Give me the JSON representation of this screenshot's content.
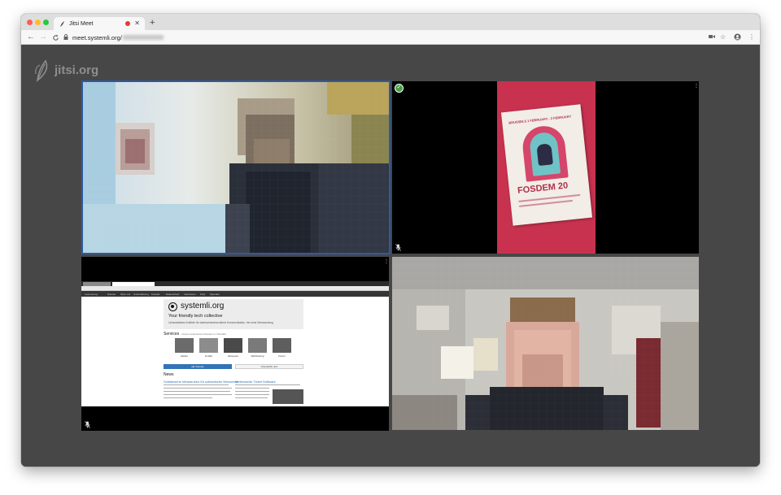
{
  "browser": {
    "tab_title": "Jitsi Meet",
    "tab_recording": true,
    "new_tab": "+",
    "url": "meet.systemli.org/",
    "nav": {
      "back": "←",
      "forward": "→",
      "reload": "C"
    },
    "icons": [
      "camera-icon",
      "star-icon",
      "account-icon",
      "menu-icon"
    ]
  },
  "app": {
    "logo_text": "jitsi.org"
  },
  "tiles": [
    {
      "id": "participant-1",
      "kind": "camera",
      "active_speaker": true
    },
    {
      "id": "participant-2",
      "kind": "camera",
      "dominant": true,
      "muted": true
    },
    {
      "id": "participant-3",
      "kind": "screen-share",
      "muted": true
    },
    {
      "id": "participant-4",
      "kind": "camera"
    }
  ],
  "fosdem_booklet": {
    "header": "BRUSSELS 1 FEBRUARY - 2 FEBRUARY",
    "title": "FOSDEM 20"
  },
  "shared_screen": {
    "site": {
      "brand": "systemli.org",
      "tagline": "Your friendly tech collective",
      "sub": "Linksradikales Kollektiv für datenschutzfreundliche Kommunikation, frei ohne Überwachung",
      "services_heading": "Services",
      "services_note": "Unsere kostenlosen Dienste im Überblick",
      "services": [
        "Jabber",
        "E-Mail",
        "Etherpad",
        "Webhosting",
        "Forum"
      ],
      "btn_primary": "alle Dienste",
      "btn_secondary": "Unterstützt uns!",
      "news_heading": "News",
      "articles": [
        "Solidarische Infrastruktur für solidarische Netzwerke",
        "Verbesserte Ticket Software"
      ]
    },
    "nav_items": [
      "systemli.org",
      "Dienste",
      "Über uns",
      "Unterstützung",
      "Kontakt",
      "Datenschutz",
      "Impressum",
      "FAQ",
      "Spenden"
    ]
  },
  "colors": {
    "stage_bg": "#474747",
    "active_border": "#2d5aa6",
    "dominant_badge": "#44a047"
  }
}
